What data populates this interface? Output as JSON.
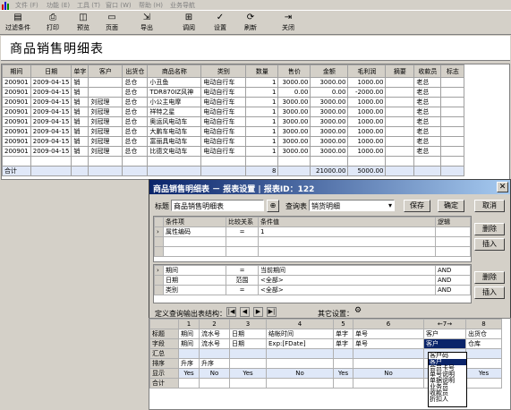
{
  "menu": [
    "文件 (F)",
    "功能 (E)",
    "工具 (T)",
    "窗口 (W)",
    "帮助 (H)",
    "业务导航"
  ],
  "toolbar": [
    {
      "label": "过滤条件",
      "icon": "filter-icon"
    },
    {
      "label": "打印",
      "icon": "printer-icon"
    },
    {
      "label": "预览",
      "icon": "preview-icon"
    },
    {
      "label": "页面",
      "icon": "page-icon"
    },
    {
      "label": "导出",
      "icon": "export-icon"
    },
    {
      "label": "调阅",
      "icon": "lookup-icon"
    },
    {
      "label": "设置",
      "icon": "settings-icon"
    },
    {
      "label": "刷新",
      "icon": "refresh-icon"
    },
    {
      "label": "关闭",
      "icon": "close-icon"
    }
  ],
  "report_title": "商品销售明细表",
  "grid": {
    "headers": [
      "期间",
      "日期",
      "单字",
      "客户",
      "出货仓",
      "商品名称",
      "类别",
      "数量",
      "售价",
      "金额",
      "毛利润",
      "摘要",
      "收款员",
      "标志"
    ],
    "rows": [
      [
        "200901",
        "2009-04-15",
        "销",
        "",
        "总仓",
        "小丑鱼",
        "电动自行车",
        "1",
        "3000.00",
        "3000.00",
        "1000.00",
        "",
        "老总",
        ""
      ],
      [
        "200901",
        "2009-04-15",
        "销",
        "",
        "总仓",
        "TDR870IZ风神",
        "电动自行车",
        "1",
        "0.00",
        "0.00",
        "-2000.00",
        "",
        "老总",
        ""
      ],
      [
        "200901",
        "2009-04-15",
        "销",
        "刘冠理",
        "总仓",
        "小公主电摩",
        "电动自行车",
        "1",
        "3000.00",
        "3000.00",
        "1000.00",
        "",
        "老总",
        ""
      ],
      [
        "200901",
        "2009-04-15",
        "销",
        "刘冠理",
        "总仓",
        "祥特之星",
        "电动自行车",
        "1",
        "3000.00",
        "3000.00",
        "1000.00",
        "",
        "老总",
        ""
      ],
      [
        "200901",
        "2009-04-15",
        "销",
        "刘冠理",
        "总仓",
        "奥运风电动车",
        "电动自行车",
        "1",
        "3000.00",
        "3000.00",
        "1000.00",
        "",
        "老总",
        ""
      ],
      [
        "200901",
        "2009-04-15",
        "销",
        "刘冠理",
        "总仓",
        "大鹏车电动车",
        "电动自行车",
        "1",
        "3000.00",
        "3000.00",
        "1000.00",
        "",
        "老总",
        ""
      ],
      [
        "200901",
        "2009-04-15",
        "销",
        "刘冠理",
        "总仓",
        "富丽具电动车",
        "电动自行车",
        "1",
        "3000.00",
        "3000.00",
        "1000.00",
        "",
        "老总",
        ""
      ],
      [
        "200901",
        "2009-04-15",
        "销",
        "刘冠理",
        "总仓",
        "比德文电动车",
        "电动自行车",
        "1",
        "3000.00",
        "3000.00",
        "1000.00",
        "",
        "老总",
        ""
      ]
    ],
    "sum": [
      "合计",
      "",
      "",
      "",
      "",
      "",
      "",
      "8",
      "",
      "21000.00",
      "5000.00",
      "",
      "",
      ""
    ]
  },
  "dialog": {
    "caption": "商品销售明细表 － 报表设置 | 报表ID：122",
    "title_label": "标题",
    "title_value": "商品销售明细表",
    "query_label": "查询表",
    "query_value": "销货明细",
    "save": "保存",
    "ok": "确定",
    "cancel": "取消",
    "cond_headers": [
      "条件项",
      "比较关系",
      "条件值",
      "逻辑"
    ],
    "cond_rows": [
      [
        "属性编码",
        "=",
        "1",
        ""
      ]
    ],
    "filter_rows": [
      [
        "期间",
        "=",
        "当前期间",
        "AND"
      ],
      [
        "日期",
        "范围",
        "<全部>",
        "AND"
      ],
      [
        "类别",
        "=",
        "<全部>",
        "AND"
      ]
    ],
    "delete1": "删除",
    "insert1": "插入",
    "delete2": "删除",
    "insert2": "插入",
    "struct_label": "定义查询输出表结构：",
    "other_label": "其它设置：",
    "bottom": {
      "col_nums": [
        "",
        "1",
        "2",
        "3",
        "4",
        "5",
        "6",
        "←7→",
        "8"
      ],
      "row_labels": [
        "标题",
        "字段",
        "汇总",
        "排序",
        "显示",
        "合计"
      ],
      "titles": [
        "期间",
        "流水号",
        "日期",
        "结帐时间",
        "单字",
        "单号",
        "客户",
        "出货仓"
      ],
      "fields": [
        "期间",
        "流水号",
        "日期",
        "Exp:[FDate]",
        "单字",
        "单号",
        "客户",
        "仓库"
      ],
      "sorts": [
        "升序",
        "升序",
        "",
        "",
        "",
        "",
        "",
        ""
      ],
      "shows": [
        "Yes",
        "No",
        "Yes",
        "No",
        "Yes",
        "No",
        "",
        "Yes"
      ]
    },
    "dropdown": [
      "客户码",
      "客户",
      "会员卡号",
      "单号说明",
      "单据说明",
      "业务员",
      "收款员",
      "折扣人"
    ]
  }
}
